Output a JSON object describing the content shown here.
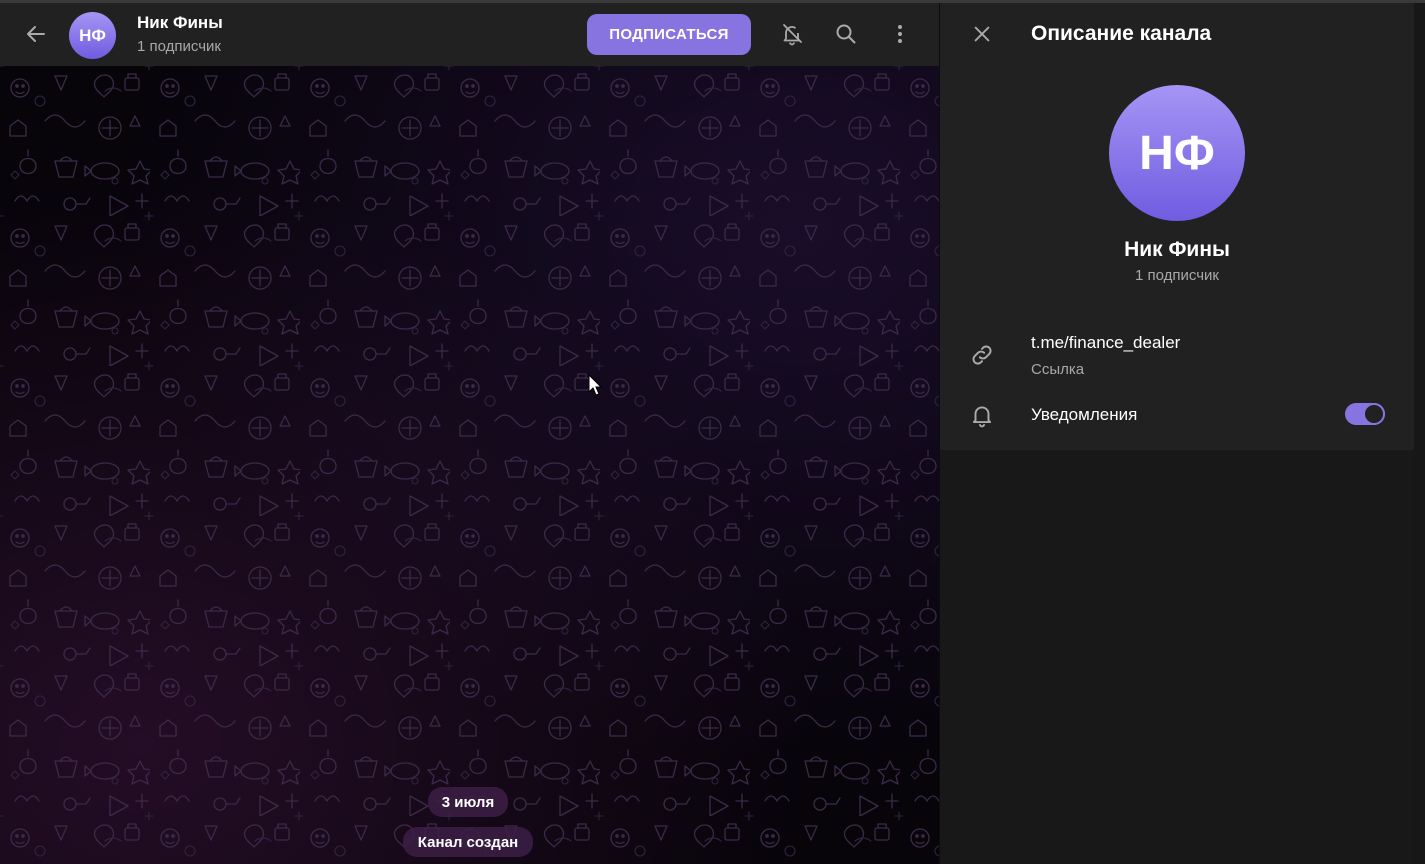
{
  "chat": {
    "avatar_initials": "НФ",
    "title": "Ник Фины",
    "subtitle": "1 подписчик",
    "subscribe_label": "ПОДПИСАТЬСЯ",
    "service_messages": [
      {
        "text": "3 июля"
      },
      {
        "text": "Канал создан"
      }
    ]
  },
  "side": {
    "title": "Описание канала",
    "avatar_initials": "НФ",
    "name": "Ник Фины",
    "subtitle": "1 подписчик",
    "link": {
      "value": "t.me/finance_dealer",
      "label": "Ссылка"
    },
    "notifications": {
      "label": "Уведомления",
      "enabled": true
    }
  },
  "colors": {
    "accent": "#8774e1",
    "header_bg": "#212121",
    "panel_bg": "#181818",
    "secondary_text": "#a8a8a8"
  },
  "icons": {
    "back": "arrow-left-icon",
    "mute": "bell-off-icon",
    "search": "search-icon",
    "more": "more-vertical-icon",
    "close": "close-icon",
    "link": "link-icon",
    "bell": "bell-icon"
  }
}
